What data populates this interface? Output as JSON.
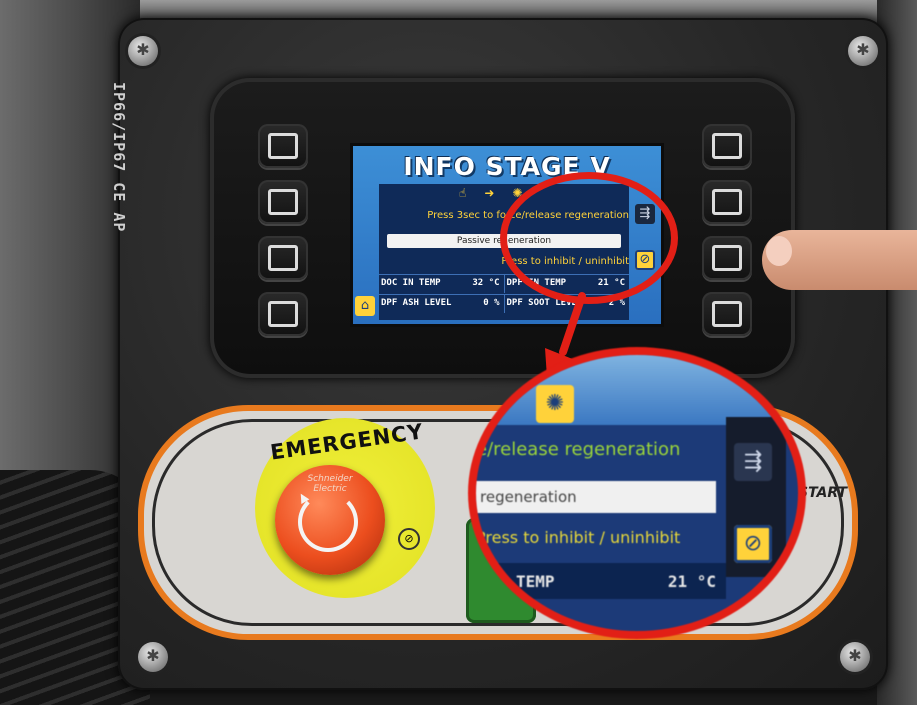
{
  "panel": {
    "certification_label": "IP66/IP67 CE AP"
  },
  "display": {
    "title": "INFO STAGE V",
    "status_icons": [
      "hand-icon",
      "arrow-icon",
      "regeneration-icon"
    ],
    "instruction_regeneration": "Press 3sec to force/release regeneration",
    "mode_value": "Passive regeneration",
    "instruction_inhibit": "Press to inhibit / uninhibit",
    "rows": [
      {
        "left_label": "DOC IN TEMP",
        "left_value": "32",
        "left_unit": "°C",
        "right_label": "DPF IN TEMP",
        "right_value": "21",
        "right_unit": "°C"
      },
      {
        "left_label": "DPF ASH LEVEL",
        "left_value": "0",
        "left_unit": "%",
        "right_label": "DPF SOOT LEVEL",
        "right_value": "2",
        "right_unit": "%"
      }
    ]
  },
  "controls": {
    "emergency_label": "EMERGENCY",
    "emergency_brand": "Schneider Electric",
    "start_label": "START"
  },
  "zoom_callout": {
    "line_regeneration": "e/release regeneration",
    "mode_value": "regeneration",
    "line_inhibit": "Press to inhibit / uninhibit",
    "data_label": "TEMP",
    "data_value": "21",
    "data_unit": "°C"
  },
  "colors": {
    "highlight_red": "#e21f16",
    "screen_blue": "#2a6fbf",
    "text_yellow": "#ffd23a",
    "emergency_yellow": "#e6e52a",
    "emergency_red": "#ec4e1e",
    "band_orange": "#e87a1e"
  }
}
